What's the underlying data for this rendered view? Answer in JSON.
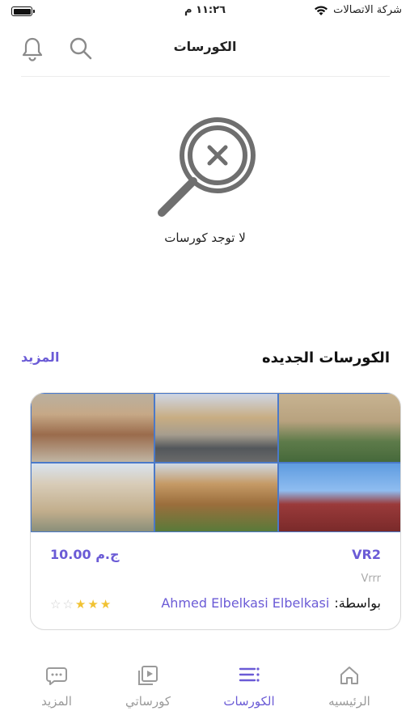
{
  "status_bar": {
    "carrier": "شركة الاتصالات",
    "time": "١١:٢٦ م"
  },
  "header": {
    "title": "الكورسات"
  },
  "empty_state": {
    "message": "لا توجد كورسات"
  },
  "new_courses": {
    "title": "الكورسات الجديده",
    "more_label": "المزيد"
  },
  "course": {
    "name": "VR2",
    "subtitle": "Vrrr",
    "price": "10.00 ج.م",
    "author_prefix": "بواسطة:",
    "author_name": "Ahmed Elbelkasi Elbelkasi",
    "rating": 3,
    "rating_max": 5
  },
  "tabs": [
    {
      "label": "الرئيسيه",
      "icon": "home-icon",
      "active": false
    },
    {
      "label": "الكورسات",
      "icon": "courses-list-icon",
      "active": true
    },
    {
      "label": "كورساتي",
      "icon": "play-video-icon",
      "active": false
    },
    {
      "label": "المزيد",
      "icon": "more-chat-icon",
      "active": false
    }
  ],
  "colors": {
    "accent": "#6b5bd6",
    "inactive": "#9a9a9a",
    "star": "#f1c232"
  }
}
